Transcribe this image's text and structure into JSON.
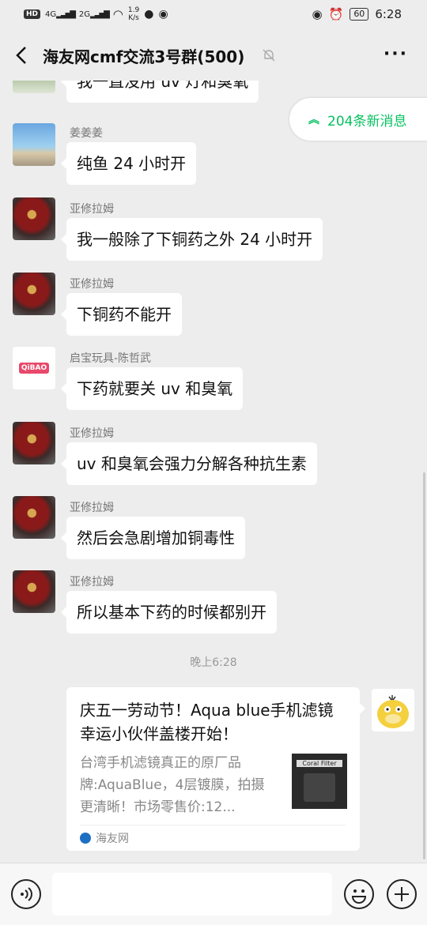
{
  "status_bar": {
    "left_badge": "HD",
    "signal1": "4G",
    "signal2": "2G",
    "net_speed_top": "1.9",
    "net_speed_bottom": "K/s",
    "battery": "60",
    "time": "6:28"
  },
  "header": {
    "title": "海友网cmf交流3号群(500)",
    "more": "···"
  },
  "new_messages": {
    "label": "204条新消息",
    "chevron": "»"
  },
  "messages": [
    {
      "sender": "",
      "text": "我一直没用 uv 灯和臭氧"
    },
    {
      "sender": "姜姜姜",
      "text": "纯鱼 24 小时开"
    },
    {
      "sender": "亚修拉姆",
      "text": "我一般除了下铜药之外 24 小时开"
    },
    {
      "sender": "亚修拉姆",
      "text": "下铜药不能开"
    },
    {
      "sender": "启宝玩具-陈哲武",
      "text": "下药就要关 uv 和臭氧"
    },
    {
      "sender": "亚修拉姆",
      "text": "uv 和臭氧会强力分解各种抗生素"
    },
    {
      "sender": "亚修拉姆",
      "text": "然后会急剧增加铜毒性"
    },
    {
      "sender": "亚修拉姆",
      "text": "所以基本下药的时候都别开"
    }
  ],
  "timestamp": "晚上6:28",
  "card": {
    "title": "庆五一劳动节！Aqua blue手机滤镜幸运小伙伴盖楼开始！",
    "description": "台湾手机滤镜真正的原厂品牌:AquaBlue，4层镀膜，拍摄更清晰！市场零售价:12...",
    "thumb_label": "Coral Filter",
    "source": "海友网"
  },
  "qibao_logo": "QiBAO",
  "colors": {
    "accent_green": "#07c160",
    "background": "#ededed"
  }
}
